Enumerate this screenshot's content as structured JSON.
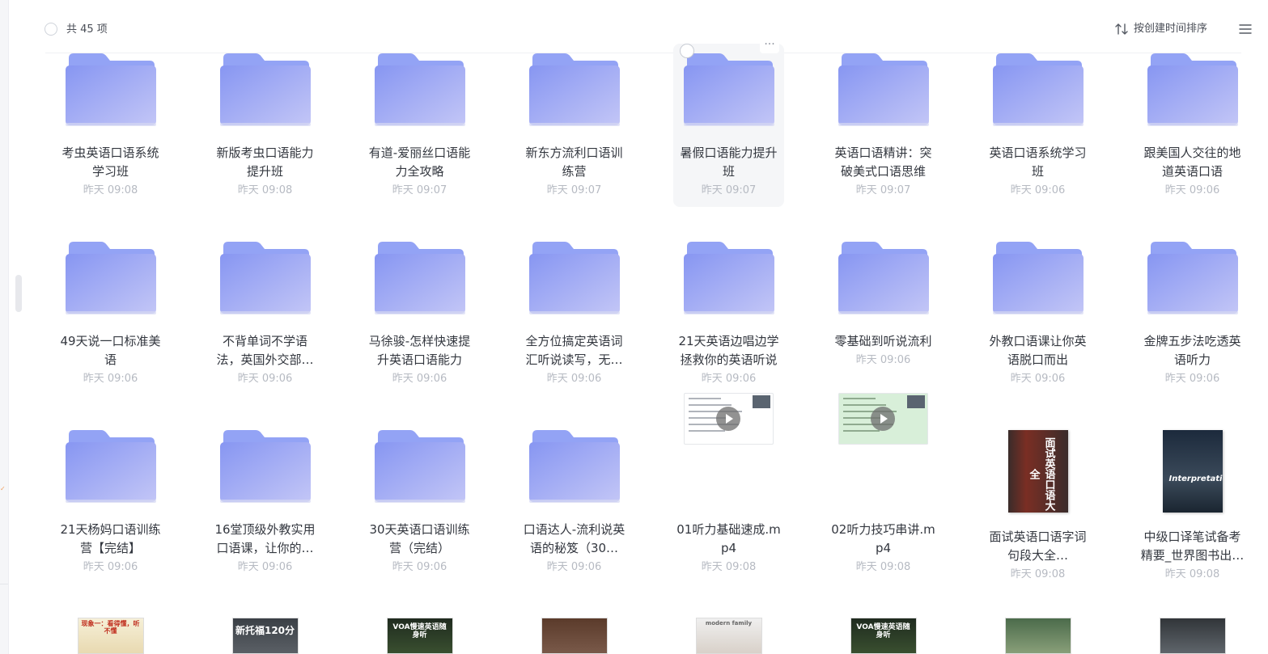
{
  "header": {
    "count_label": "共 45 项",
    "sort_label": "按创建时间排序"
  },
  "colors": {
    "folder_top": "#93a3f5",
    "folder_body": "#b7bef6",
    "time_text": "#b6bac2"
  },
  "rows": [
    [
      {
        "type": "folder",
        "name": "考虫英语口语系统学习班",
        "time": "昨天 09:08"
      },
      {
        "type": "folder",
        "name": "新版考虫口语能力提升班",
        "time": "昨天 09:08"
      },
      {
        "type": "folder",
        "name": "有道-爱丽丝口语能力全攻略",
        "time": "昨天 09:07"
      },
      {
        "type": "folder",
        "name": "新东方流利口语训练营",
        "time": "昨天 09:07"
      },
      {
        "type": "folder",
        "name": "暑假口语能力提升班",
        "time": "昨天 09:07",
        "hover": true
      },
      {
        "type": "folder",
        "name": "英语口语精讲：突破美式口语思维",
        "time": "昨天 09:07"
      },
      {
        "type": "folder",
        "name": "英语口语系统学习班",
        "time": "昨天 09:06"
      },
      {
        "type": "folder",
        "name": "跟美国人交往的地道英语口语",
        "time": "昨天 09:06"
      }
    ],
    [
      {
        "type": "folder",
        "name": "49天说一口标准美语",
        "time": "昨天 09:06"
      },
      {
        "type": "folder",
        "name": "不背单词不学语法，英国外交部…",
        "time": "昨天 09:06"
      },
      {
        "type": "folder",
        "name": "马徐骏-怎样快速提升英语口语能力",
        "time": "昨天 09:06"
      },
      {
        "type": "folder",
        "name": "全方位搞定英语词汇听说读写，无…",
        "time": "昨天 09:06"
      },
      {
        "type": "folder",
        "name": "21天英语边唱边学拯救你的英语听说",
        "time": "昨天 09:06"
      },
      {
        "type": "folder",
        "name": "零基础到听说流利",
        "time": "昨天 09:06",
        "single": true
      },
      {
        "type": "folder",
        "name": "外教口语课让你英语脱口而出",
        "time": "昨天 09:06"
      },
      {
        "type": "folder",
        "name": "金牌五步法吃透英语听力",
        "time": "昨天 09:06"
      }
    ],
    [
      {
        "type": "folder",
        "name": "21天杨妈口语训练营【完结】",
        "time": "昨天 09:06"
      },
      {
        "type": "folder",
        "name": "16堂顶级外教实用口语课，让你的…",
        "time": "昨天 09:06"
      },
      {
        "type": "folder",
        "name": "30天英语口语训练营（完结）",
        "time": "昨天 09:06"
      },
      {
        "type": "folder",
        "name": "口语达人-流利说英语的秘笈（30…",
        "time": "昨天 09:06"
      },
      {
        "type": "video",
        "name": "01听力基础速成.mp4",
        "time": "昨天 09:08",
        "style": "white"
      },
      {
        "type": "video",
        "name": "02听力技巧串讲.mp4",
        "time": "昨天 09:08",
        "style": "green"
      },
      {
        "type": "book",
        "name": "面试英语口语字词句段大全…",
        "time": "昨天 09:08",
        "cover_text": "面试英语口语大全"
      },
      {
        "type": "book",
        "name": "中级口译笔试备考精要_世界图书出…",
        "time": "昨天 09:08",
        "cover_text": "Interpretation"
      }
    ]
  ],
  "bottom_row": [
    {
      "type": "cover",
      "cover_text": "现象一：看得懂，听不懂"
    },
    {
      "type": "cover",
      "cover_text": "新托福120分"
    },
    {
      "type": "cover",
      "cover_text": "VOA慢速英语随身听"
    },
    {
      "type": "cover",
      "cover_text": ""
    },
    {
      "type": "cover",
      "cover_text": "modern family"
    },
    {
      "type": "cover",
      "cover_text": "VOA慢速英语随身听"
    },
    {
      "type": "cover",
      "cover_text": ""
    },
    {
      "type": "cover",
      "cover_text": ""
    }
  ]
}
